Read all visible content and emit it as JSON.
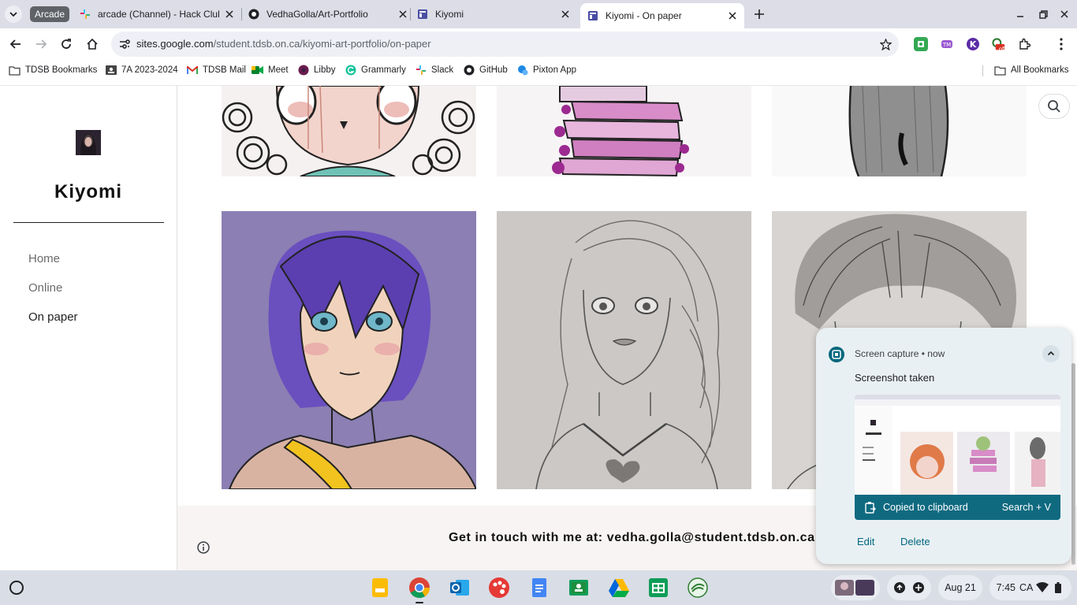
{
  "browser": {
    "tab_group_label": "Arcade",
    "tabs": [
      {
        "title": "arcade (Channel) - Hack Club -",
        "favicon": "slack-icon"
      },
      {
        "title": "VedhaGolla/Art-Portfolio",
        "favicon": "github-icon"
      },
      {
        "title": "Kiyomi",
        "favicon": "google-sites-icon"
      },
      {
        "title": "Kiyomi - On paper",
        "favicon": "google-sites-icon",
        "active": true
      }
    ],
    "url_host": "sites.google.com",
    "url_path": "/student.tdsb.on.ca/kiyomi-art-portfolio/on-paper",
    "extension_badge": "off",
    "bookmarks": [
      {
        "label": "TDSB Bookmarks",
        "icon": "folder-icon"
      },
      {
        "label": "7A 2023-2024",
        "icon": "classroom-icon"
      },
      {
        "label": "TDSB Mail",
        "icon": "gmail-icon"
      },
      {
        "label": "Meet",
        "icon": "meet-icon"
      },
      {
        "label": "Libby",
        "icon": "libby-icon"
      },
      {
        "label": "Grammarly",
        "icon": "grammarly-icon"
      },
      {
        "label": "Slack",
        "icon": "slack-icon"
      },
      {
        "label": "GitHub",
        "icon": "github-icon"
      },
      {
        "label": "Pixton App",
        "icon": "pixton-icon"
      }
    ],
    "all_bookmarks_label": "All Bookmarks"
  },
  "site": {
    "name": "Kiyomi",
    "nav": [
      {
        "label": "Home"
      },
      {
        "label": "Online"
      },
      {
        "label": "On paper",
        "current": true
      }
    ],
    "footer_text": "Get in touch with me at: vedha.golla@student.tdsb.on.ca",
    "artworks": [
      {
        "subject": "chibi girl with curly hair, colored pencil"
      },
      {
        "subject": "stack of pink books, colored pencil"
      },
      {
        "subject": "figure with long dark hair, pencil"
      },
      {
        "subject": "anime girl with purple hair, colored pencil"
      },
      {
        "subject": "girl with wavy hair, pencil sketch"
      },
      {
        "subject": "figure with bangs, pencil sketch"
      }
    ]
  },
  "notification": {
    "app_name": "Screen capture",
    "time": "now",
    "title": "Screenshot taken",
    "copied_label": "Copied to clipboard",
    "paste_hint": "Search + V",
    "edit_label": "Edit",
    "delete_label": "Delete",
    "accent": "#0f6a80"
  },
  "shelf": {
    "apps": [
      "keep-icon",
      "chrome-icon",
      "outlook-icon",
      "canvas-paint-icon",
      "docs-icon",
      "classroom-icon",
      "drive-icon",
      "sheets-icon",
      "vpn-icon"
    ],
    "date": "Aug 21",
    "time": "7:45",
    "region": "CA"
  }
}
